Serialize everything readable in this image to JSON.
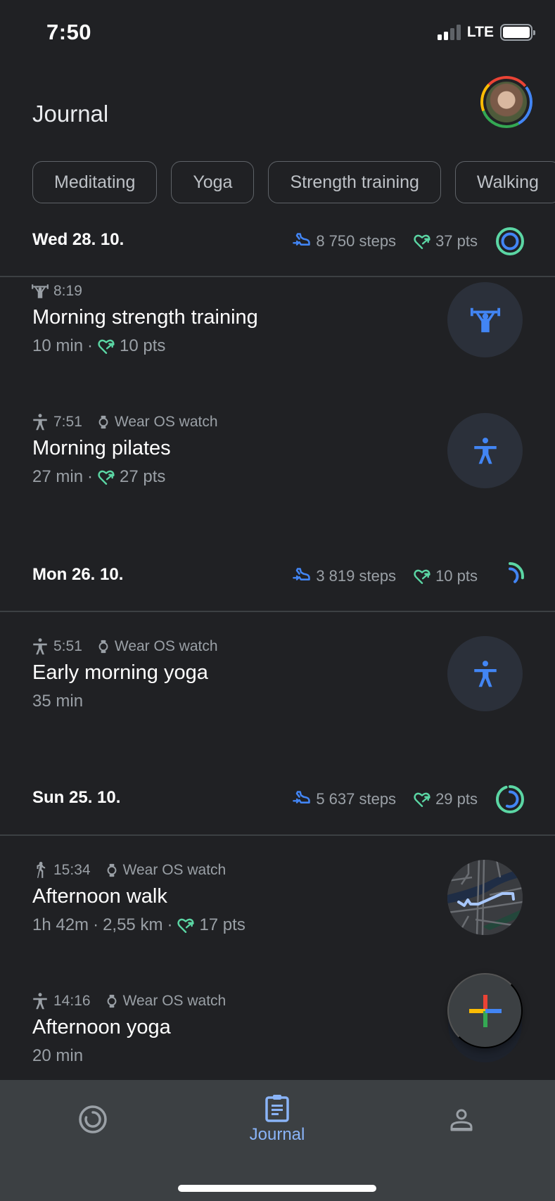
{
  "status_bar": {
    "time": "7:50",
    "network": "LTE",
    "signal_bars_active": 2,
    "signal_bars_total": 4,
    "battery_level": 1.0
  },
  "header": {
    "title": "Journal",
    "avatar_icon": "profile-avatar"
  },
  "filter_chips": [
    {
      "label": "Meditating"
    },
    {
      "label": "Yoga"
    },
    {
      "label": "Strength training"
    },
    {
      "label": "Walking"
    }
  ],
  "days": [
    {
      "date": "Wed 28. 10.",
      "steps": "8 750 steps",
      "points": "37 pts",
      "ring": {
        "heart_points_progress": 1.0,
        "steps_progress": 1.0
      },
      "activities": [
        {
          "type_icon": "strength-training-icon",
          "time": "8:19",
          "device": "",
          "title": "Morning strength training",
          "duration": "10 min",
          "distance": "",
          "points": "10 pts"
        },
        {
          "type_icon": "pilates-icon",
          "time": "7:51",
          "device": "Wear OS watch",
          "title": "Morning pilates",
          "duration": "27 min",
          "distance": "",
          "points": "27 pts"
        }
      ]
    },
    {
      "date": "Mon 26. 10.",
      "steps": "3 819 steps",
      "points": "10 pts",
      "ring": {
        "heart_points_progress": 0.27,
        "steps_progress": 0.38
      },
      "activities": [
        {
          "type_icon": "yoga-icon",
          "time": "5:51",
          "device": "Wear OS watch",
          "title": "Early morning yoga",
          "duration": "35 min",
          "distance": "",
          "points": ""
        }
      ]
    },
    {
      "date": "Sun 25. 10.",
      "steps": "5 637 steps",
      "points": "29 pts",
      "ring": {
        "heart_points_progress": 0.95,
        "steps_progress": 0.56
      },
      "activities": [
        {
          "type_icon": "walking-icon",
          "time": "15:34",
          "device": "Wear OS watch",
          "title": "Afternoon walk",
          "duration": "1h 42m",
          "distance": "2,55 km",
          "points": "17 pts"
        },
        {
          "type_icon": "yoga-icon",
          "time": "14:16",
          "device": "Wear OS watch",
          "title": "Afternoon yoga",
          "duration": "20 min",
          "distance": "",
          "points": ""
        }
      ]
    }
  ],
  "fab": {
    "icon": "add-activity-icon"
  },
  "bottom_nav": [
    {
      "id": "home",
      "label": "",
      "icon": "home-ring-icon",
      "active": false
    },
    {
      "id": "journal",
      "label": "Journal",
      "icon": "journal-clipboard-icon",
      "active": true
    },
    {
      "id": "profile",
      "label": "",
      "icon": "profile-icon",
      "active": false
    }
  ],
  "colors": {
    "background": "#202124",
    "accent_blue": "#4285f4",
    "heart_points_green": "#5bd6a4",
    "nav_active": "#8ab4f8",
    "secondary_text": "#9aa0a6"
  },
  "separator": " · "
}
